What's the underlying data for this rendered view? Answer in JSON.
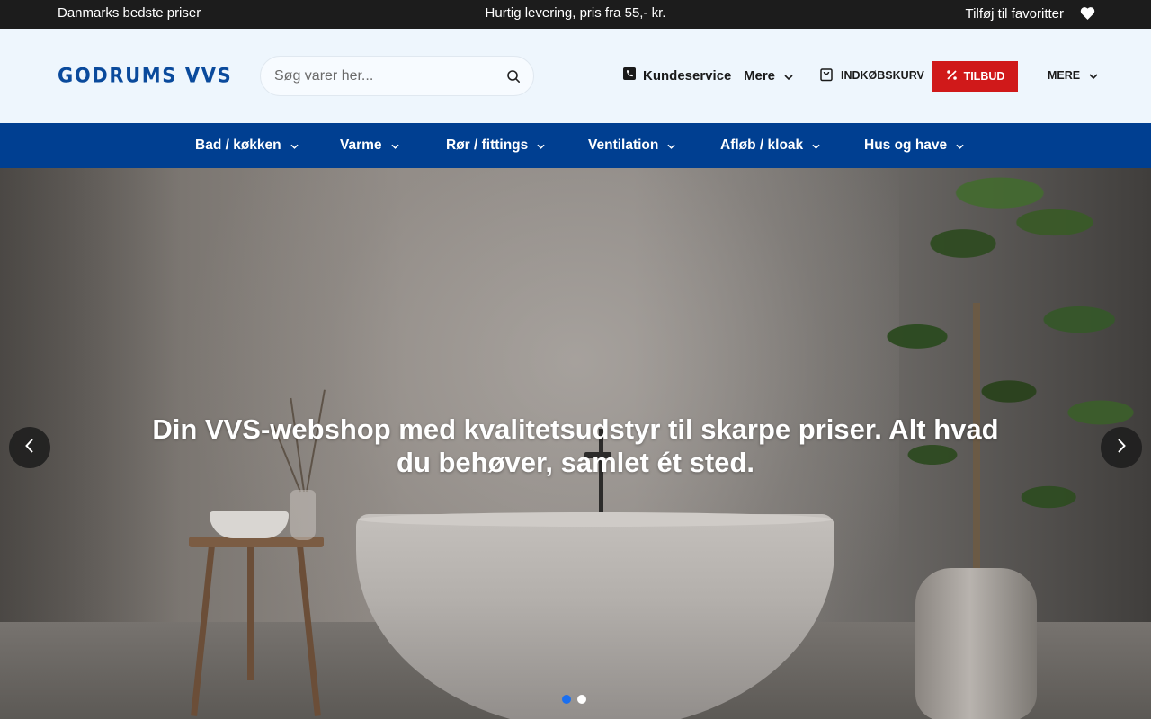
{
  "topbar": {
    "left_text": "Danmarks bedste priser",
    "center_text": "Hurtig levering, pris fra 55,- kr.",
    "favorites_label": "Tilføj til favoritter",
    "favorites_icon": "heart-icon"
  },
  "header": {
    "logo_text": "GODRUMS VVS",
    "search": {
      "placeholder": "Søg varer her...",
      "value": "",
      "icon": "search-icon"
    },
    "customer_service_label": "Kundeservice",
    "customer_service_icon": "phone-icon",
    "more_label": "Mere",
    "cart_label": "INDKØBSKURV",
    "cart_icon": "shopping-bag-icon",
    "offer_label": "TILBUD",
    "offer_icon": "percent-icon",
    "more_caps_label": "MERE"
  },
  "main_nav": {
    "items": [
      {
        "label": "Bad / køkken"
      },
      {
        "label": "Varme"
      },
      {
        "label": "Rør / fittings"
      },
      {
        "label": "Ventilation"
      },
      {
        "label": "Afløb / kloak"
      },
      {
        "label": "Hus og have"
      }
    ]
  },
  "hero": {
    "headline": "Din VVS-webshop med kvalitetsudstyr til skarpe priser. Alt hvad du behøver, samlet ét sted.",
    "slide_count": 2,
    "active_slide": 1
  },
  "colors": {
    "topbar_bg": "#1c1c1c",
    "header_bg": "#eef6fd",
    "nav_bg": "#003f91",
    "logo": "#0a4a9c",
    "offer_bg": "#d0191a",
    "active_dot": "#1a6ff0"
  }
}
